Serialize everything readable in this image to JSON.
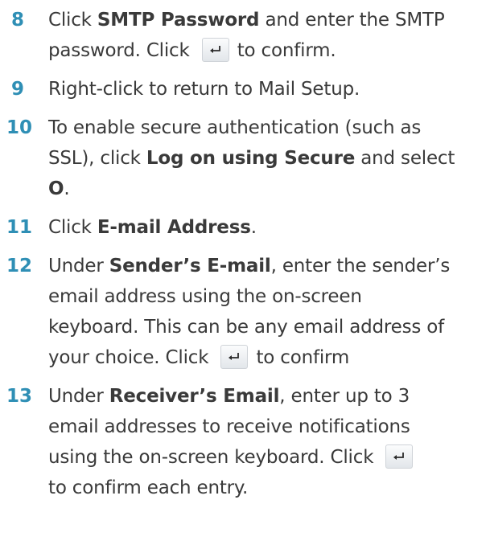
{
  "steps": [
    {
      "number": "8",
      "lines": [
        {
          "a": "Click ",
          "b": "SMTP Password",
          "c": " and enter the SMTP"
        },
        {
          "a": "password. Click ",
          "icon": "enter-icon",
          "c": "to confirm."
        }
      ]
    },
    {
      "number": "9",
      "lines": [
        {
          "a": "Right-click to return to Mail Setup."
        }
      ]
    },
    {
      "number": "10",
      "lines": [
        {
          "a": "To enable secure authentication (such as"
        },
        {
          "a": "SSL), click ",
          "b": "Log on using Secure",
          "c": " and select"
        },
        {
          "b": "O",
          "c": "."
        }
      ]
    },
    {
      "number": "11",
      "lines": [
        {
          "a": "Click ",
          "b": "E-mail Address",
          "c": "."
        }
      ]
    },
    {
      "number": "12",
      "lines": [
        {
          "a": "Under ",
          "b": "Sender’s E-mail",
          "c": ", enter the sender’s"
        },
        {
          "a": "email address using the on-screen"
        },
        {
          "a": "keyboard. This can be any email address of"
        },
        {
          "a": "your choice. Click ",
          "icon": "enter-icon",
          "c": "to confirm"
        }
      ]
    },
    {
      "number": "13",
      "lines": [
        {
          "a": "Under ",
          "b": "Receiver’s Email",
          "c": ", enter up to 3"
        },
        {
          "a": "email addresses to receive notifications"
        },
        {
          "a": "using the on-screen keyboard. Click ",
          "icon": "enter-icon"
        },
        {
          "a": "to confirm each entry."
        }
      ]
    }
  ]
}
